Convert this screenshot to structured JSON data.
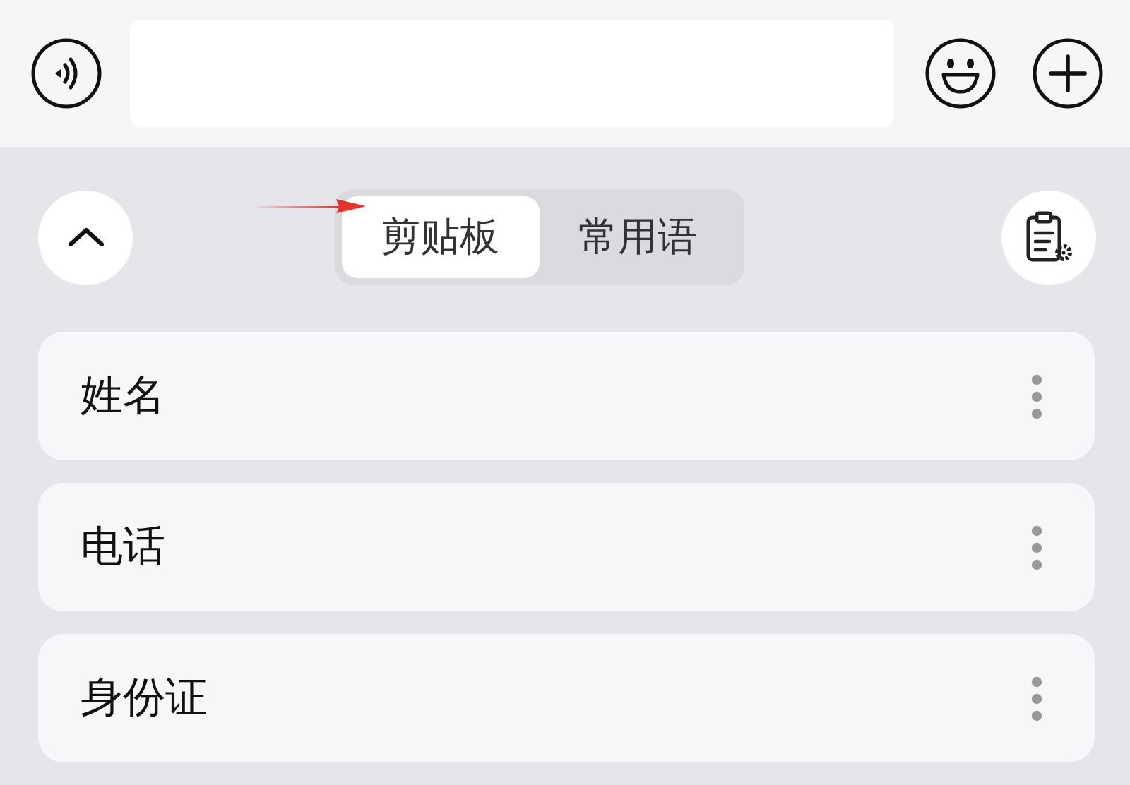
{
  "panel": {
    "tabs": [
      {
        "label": "剪贴板",
        "selected": true
      },
      {
        "label": "常用语",
        "selected": false
      }
    ]
  },
  "items": [
    {
      "label": "姓名"
    },
    {
      "label": "电话"
    },
    {
      "label": "身份证"
    }
  ]
}
